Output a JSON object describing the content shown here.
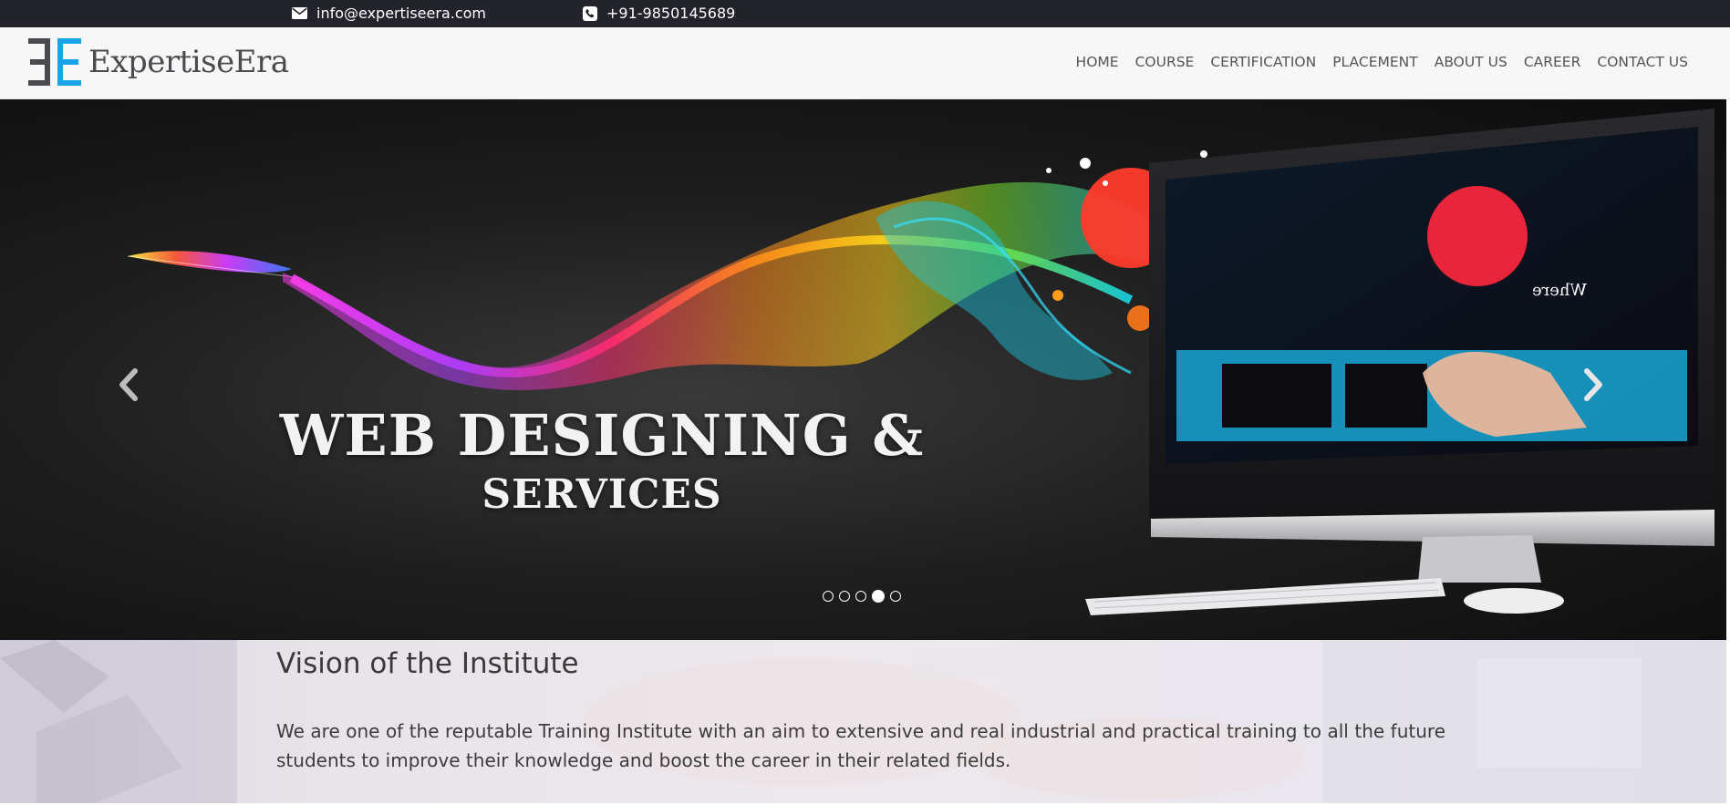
{
  "topbar": {
    "email": "info@expertiseera.com",
    "phone": "+91-9850145689",
    "email_icon": "envelope-icon",
    "phone_icon": "phone-icon"
  },
  "brand": {
    "name": "ExpertiseEra",
    "logo_icon": "ee-logo-icon",
    "logo_colors": {
      "left": "#4a4a4f",
      "right": "#1aa3e8"
    }
  },
  "nav": {
    "items": [
      "HOME",
      "COURSE",
      "CERTIFICATION",
      "PLACEMENT",
      "ABOUT US",
      "CAREER",
      "CONTACT US"
    ]
  },
  "hero": {
    "headline_line1": "WEB DESIGNING &",
    "headline_line2": "SERVICES",
    "prev_icon": "chevron-left-icon",
    "next_icon": "chevron-right-icon",
    "slides_count": 5,
    "active_slide": 4
  },
  "vision": {
    "title": "Vision of the Institute",
    "text": "We are one of the reputable Training Institute with an aim to extensive and real industrial and practical training to all the future students to improve their knowledge and boost the career in their related fields."
  },
  "colors": {
    "topbar_bg": "#23232b",
    "header_bg": "#f7f7f7",
    "accent": "#1aa3e8"
  }
}
